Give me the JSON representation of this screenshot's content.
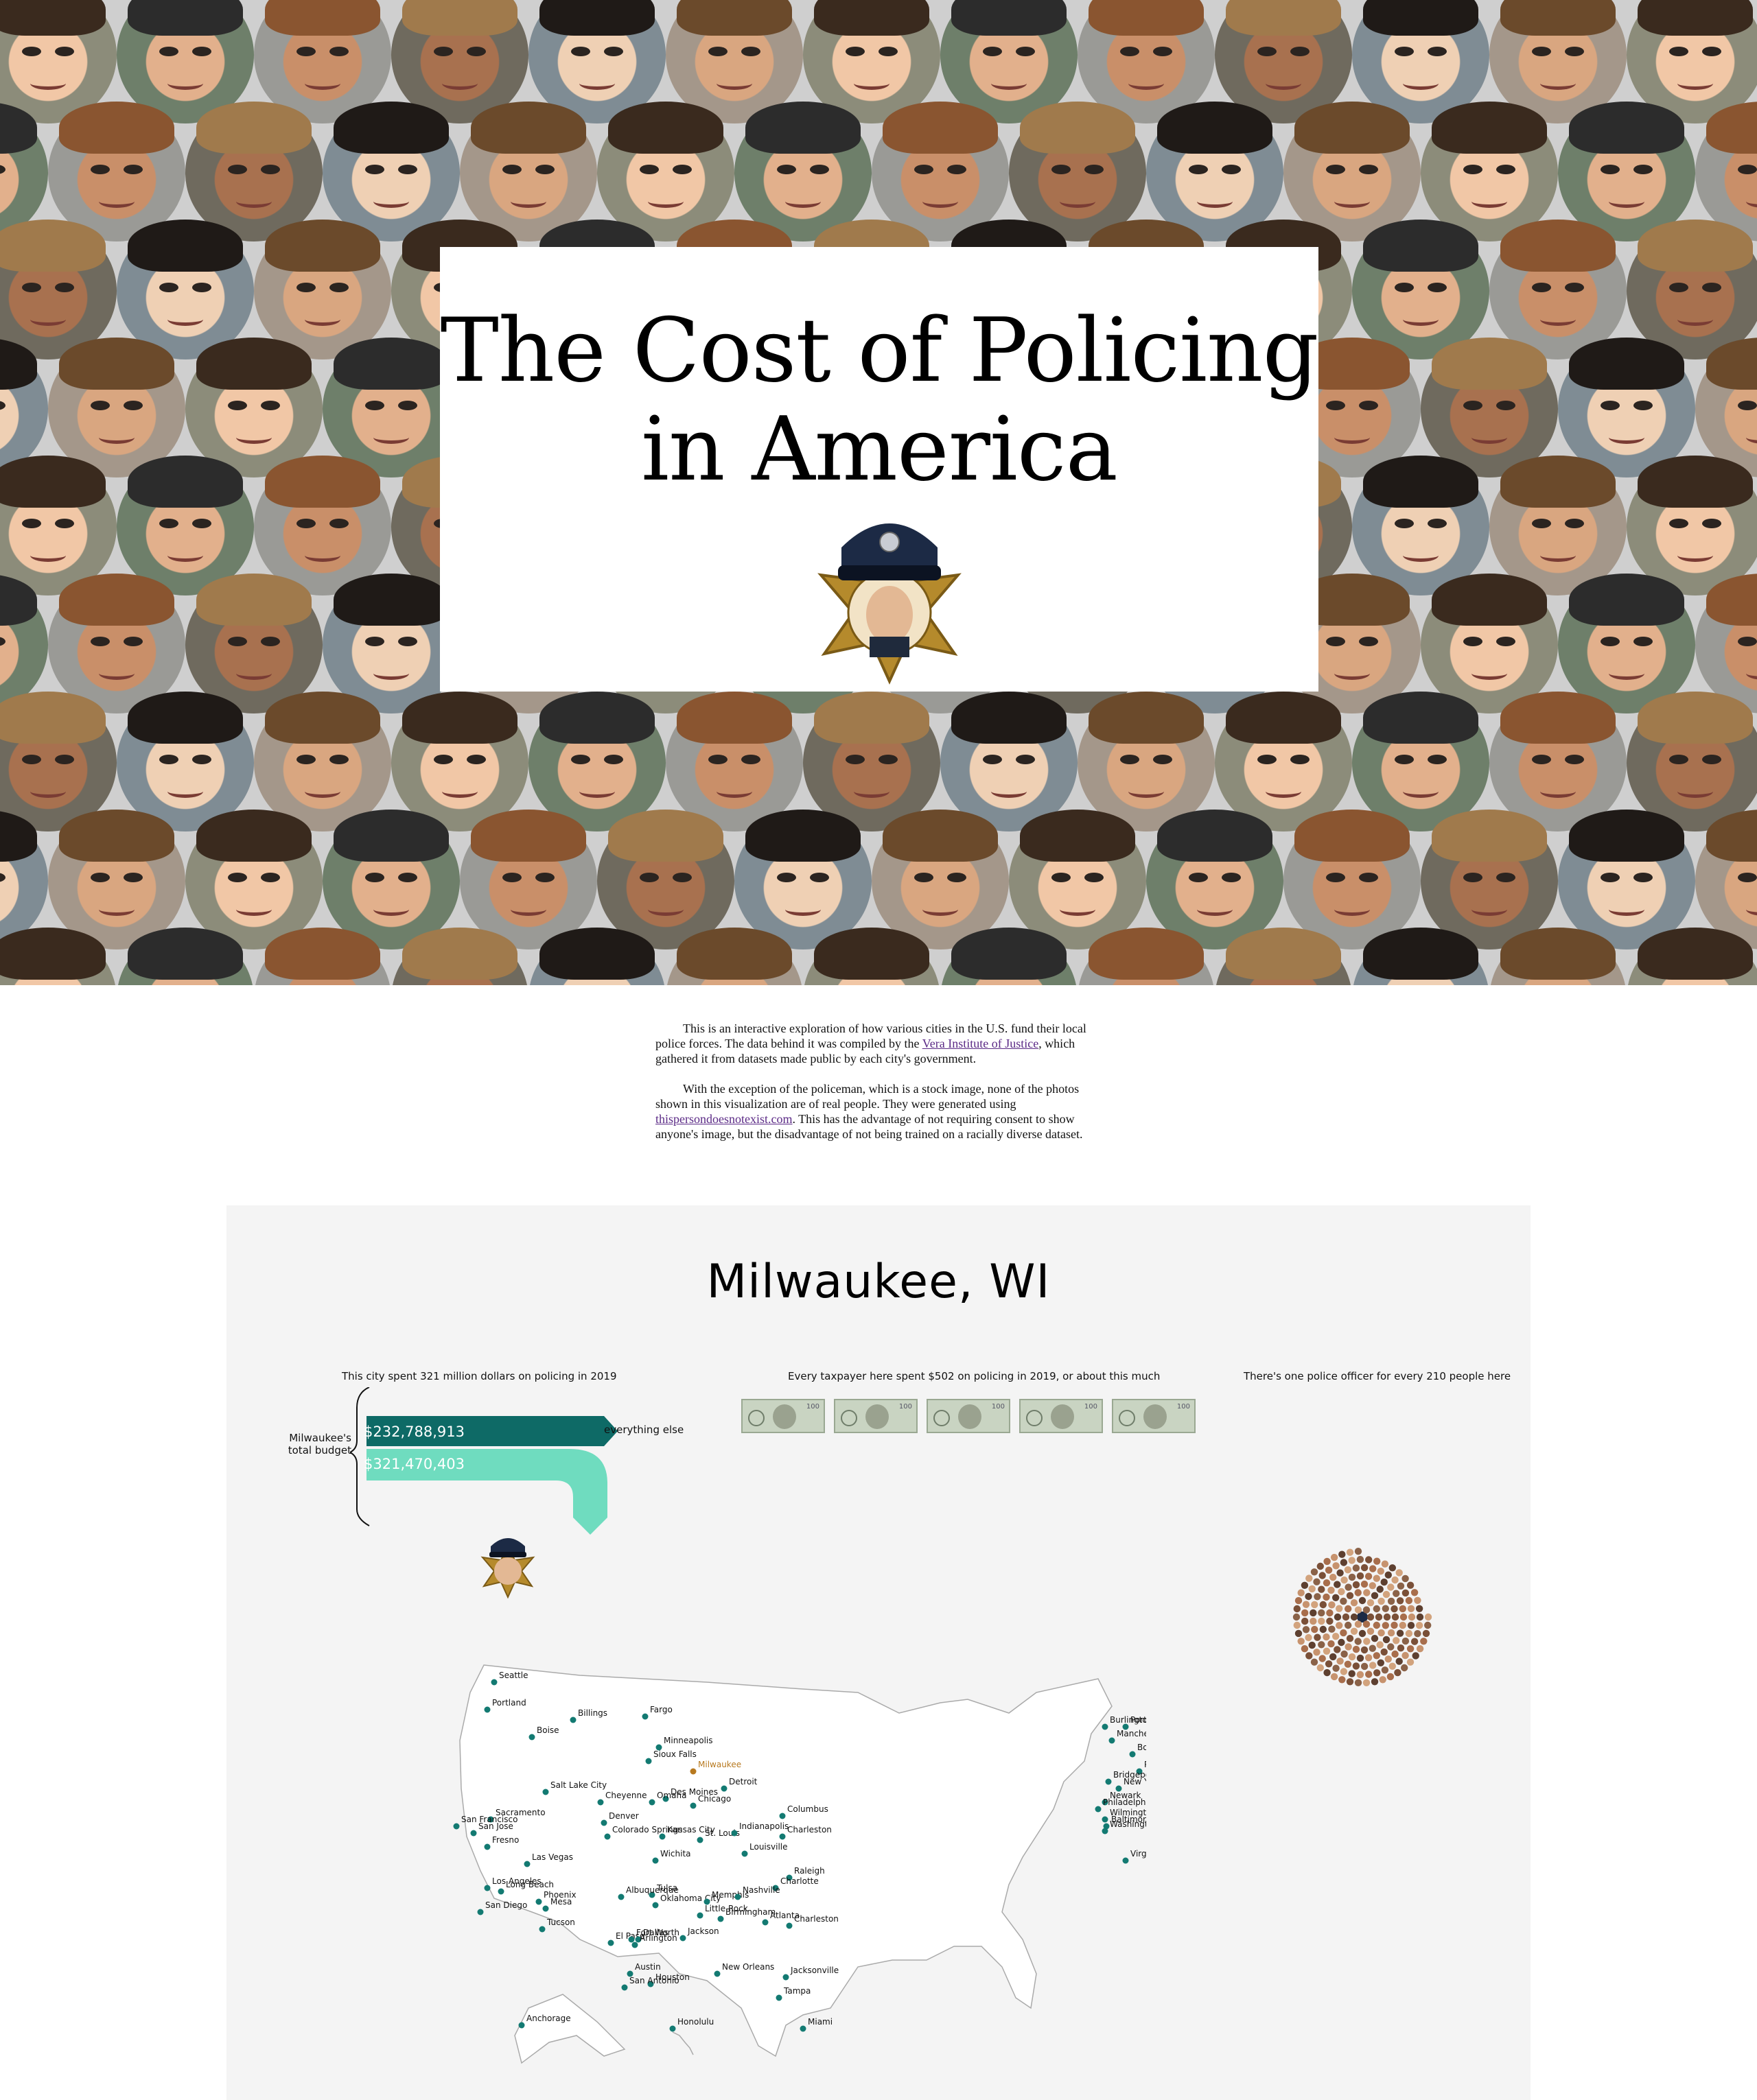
{
  "header": {
    "title_line1": "The Cost of Policing",
    "title_line2": "in America"
  },
  "intro": {
    "p1_text": "This is an interactive exploration of how various cities in the U.S. fund their local police forces. The data behind it was compiled by the ",
    "p1_link": "Vera Institute of Justice",
    "p1_rest": ", which gathered it from datasets made public by each city's government.",
    "p2_text": "With the exception of the policeman, which is a stock image, none of the photos shown in this visualization are of real people. They were generated using ",
    "p2_link": "thispersondoesnotexist.com",
    "p2_rest": ". This has the advantage of not requiring consent to show anyone's image, but the disadvantage of not being trained on a racially diverse dataset."
  },
  "city": {
    "name": "Milwaukee, WI",
    "spent_caption": "This city spent 321 million dollars on policing in 2019",
    "taxpayer_caption": "Every taxpayer here spent $502 on policing in 2019, or about this much",
    "officer_caption": "There's one police officer for every 210 people here",
    "budget_label_line1": "Milwaukee's",
    "budget_label_line2": "total budget",
    "everything_else_label": "everything else",
    "everything_else_amount": "$232,788,913",
    "police_amount": "$321,470,403",
    "bill_count": 5,
    "people_per_officer": 210
  },
  "colors": {
    "everything_else": "#0e6a66",
    "police": "#7be0c4",
    "map_dot": "#137a72",
    "selected_city": "#b7791f"
  },
  "map": {
    "selected": "Milwaukee",
    "cities": [
      "Seattle",
      "Portland",
      "Billings",
      "Fargo",
      "Burlington",
      "Portland",
      "Manchester",
      "Boston",
      "Boise",
      "Minneapolis",
      "Sioux Falls",
      "Milwaukee",
      "Providence",
      "Bridgeport",
      "New York",
      "Salt Lake City",
      "Cheyenne",
      "Des Moines",
      "Omaha",
      "Detroit",
      "Chicago",
      "Newark",
      "Philadelphia",
      "Columbus",
      "Wilmington",
      "Baltimore",
      "Washington",
      "Sacramento",
      "San Francisco",
      "Denver",
      "San Jose",
      "Fresno",
      "Colorado Springs",
      "Kansas City",
      "St. Louis",
      "Indianapolis",
      "Charleston",
      "Louisville",
      "Virginia Beach",
      "Las Vegas",
      "Wichita",
      "Raleigh",
      "Los Angeles",
      "Long Beach",
      "Tulsa",
      "Charlotte",
      "Phoenix",
      "Albuquerque",
      "Oklahoma City",
      "Memphis",
      "Nashville",
      "Mesa",
      "San Diego",
      "Little Rock",
      "Birmingham",
      "Atlanta",
      "Tucson",
      "Charleston",
      "El Paso",
      "Fort Worth",
      "Dallas",
      "Jackson",
      "Arlington",
      "Austin",
      "New Orleans",
      "Jacksonville",
      "Houston",
      "San Antonio",
      "Anchorage",
      "Honolulu",
      "Tampa",
      "Miami"
    ]
  }
}
